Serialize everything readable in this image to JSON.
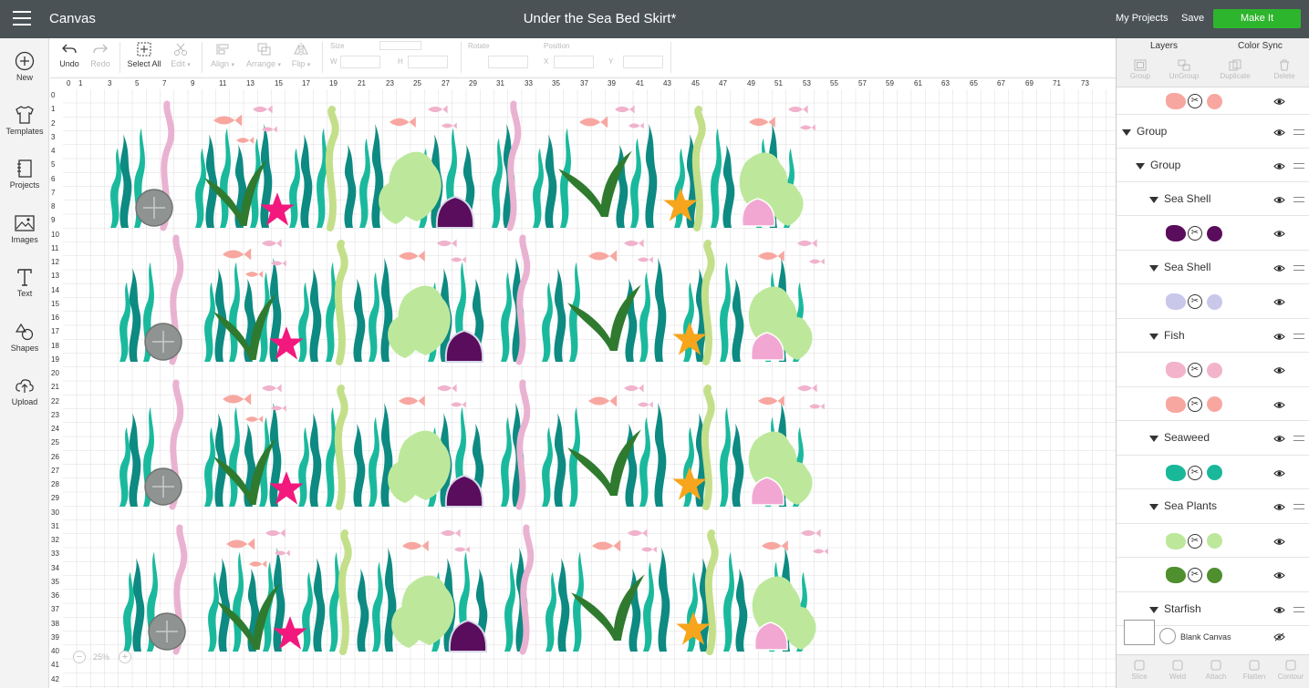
{
  "app": {
    "name": "Canvas",
    "title": "Under the Sea Bed Skirt*"
  },
  "header": {
    "my_projects": "My Projects",
    "save": "Save",
    "make_it": "Make It",
    "make_color": "#2db52d"
  },
  "left_nav": [
    {
      "label": "New",
      "icon": "plus-circle-icon"
    },
    {
      "label": "Templates",
      "icon": "shirt-icon"
    },
    {
      "label": "Projects",
      "icon": "notebook-icon"
    },
    {
      "label": "Images",
      "icon": "image-icon"
    },
    {
      "label": "Text",
      "icon": "text-t-icon"
    },
    {
      "label": "Shapes",
      "icon": "shapes-icon"
    },
    {
      "label": "Upload",
      "icon": "cloud-upload-icon"
    }
  ],
  "toolbar": {
    "undo": "Undo",
    "redo": "Redo",
    "select_all": "Select All",
    "edit": "Edit",
    "align": "Align",
    "arrange": "Arrange",
    "flip": "Flip",
    "size": "Size",
    "w": "W",
    "h": "H",
    "rotate": "Rotate",
    "position": "Position",
    "x": "X",
    "y": "Y"
  },
  "ruler": {
    "top": [
      "0",
      "1",
      "3",
      "5",
      "7",
      "9",
      "11",
      "13",
      "15",
      "17",
      "19",
      "21",
      "23",
      "25",
      "27",
      "29",
      "31",
      "33",
      "35",
      "37",
      "39",
      "41",
      "43",
      "45",
      "47",
      "49",
      "51",
      "53",
      "55",
      "57",
      "59",
      "61",
      "63",
      "65",
      "67",
      "69",
      "71",
      "73"
    ],
    "left": [
      "0",
      "1",
      "2",
      "3",
      "4",
      "5",
      "6",
      "7",
      "8",
      "9",
      "10",
      "11",
      "12",
      "13",
      "14",
      "15",
      "16",
      "17",
      "18",
      "19",
      "20",
      "21",
      "22",
      "23",
      "24",
      "25",
      "26",
      "27",
      "28",
      "29",
      "30",
      "31",
      "32",
      "33",
      "34",
      "35",
      "36",
      "37",
      "38",
      "39",
      "40",
      "41",
      "42"
    ]
  },
  "zoom": {
    "value": "25%",
    "minus": "−",
    "plus": "+"
  },
  "right_panel": {
    "tabs": {
      "layers": "Layers",
      "color_sync": "Color Sync"
    },
    "tools": [
      "Group",
      "UnGroup",
      "Duplicate",
      "Delete"
    ],
    "layers": [
      {
        "kind": "item",
        "color": "#f7a7a0",
        "thumb": "#f7a7a0"
      },
      {
        "kind": "group",
        "label": "Group",
        "level": 0
      },
      {
        "kind": "group",
        "label": "Group",
        "level": 1
      },
      {
        "kind": "group",
        "label": "Sea Shell",
        "level": 2
      },
      {
        "kind": "item",
        "color": "#5a0d5c",
        "thumb": "#5a0d5c"
      },
      {
        "kind": "group",
        "label": "Sea Shell",
        "level": 2
      },
      {
        "kind": "item",
        "color": "#c9c7ea",
        "thumb": "#c9c7ea"
      },
      {
        "kind": "group",
        "label": "Fish",
        "level": 2
      },
      {
        "kind": "item",
        "color": "#f3b3cb",
        "thumb": "#f3b3cb"
      },
      {
        "kind": "item",
        "color": "#f7a7a0",
        "thumb": "#f7a7a0"
      },
      {
        "kind": "group",
        "label": "Seaweed",
        "level": 2
      },
      {
        "kind": "item",
        "color": "#19b89a",
        "thumb": "#19b89a"
      },
      {
        "kind": "group",
        "label": "Sea Plants",
        "level": 2
      },
      {
        "kind": "item",
        "color": "#bde89c",
        "thumb": "#bde89c"
      },
      {
        "kind": "item",
        "color": "#4f8f2e",
        "thumb": "#4f8f2e"
      },
      {
        "kind": "group",
        "label": "Starfish",
        "level": 2
      }
    ],
    "blank_canvas": "Blank Canvas",
    "bottom_tools": [
      "Slice",
      "Weld",
      "Attach",
      "Flatten",
      "Contour"
    ]
  },
  "colors": {
    "teal": "#1ab99d",
    "dark_teal": "#0d8a82",
    "pink_weed": "#eab2d1",
    "lime_weed": "#c4df8a",
    "fish_salmon": "#f7a7a0",
    "fish_pink": "#f0b2cc",
    "sand_dollar": "#8f9391",
    "dark_leaf": "#2f7a2f",
    "magenta_star": "#f2187e",
    "purple_shell": "#5a0d5c",
    "light_green": "#bde89c",
    "orange_star": "#f7a51d",
    "pink_shell": "#f2a7d2"
  }
}
